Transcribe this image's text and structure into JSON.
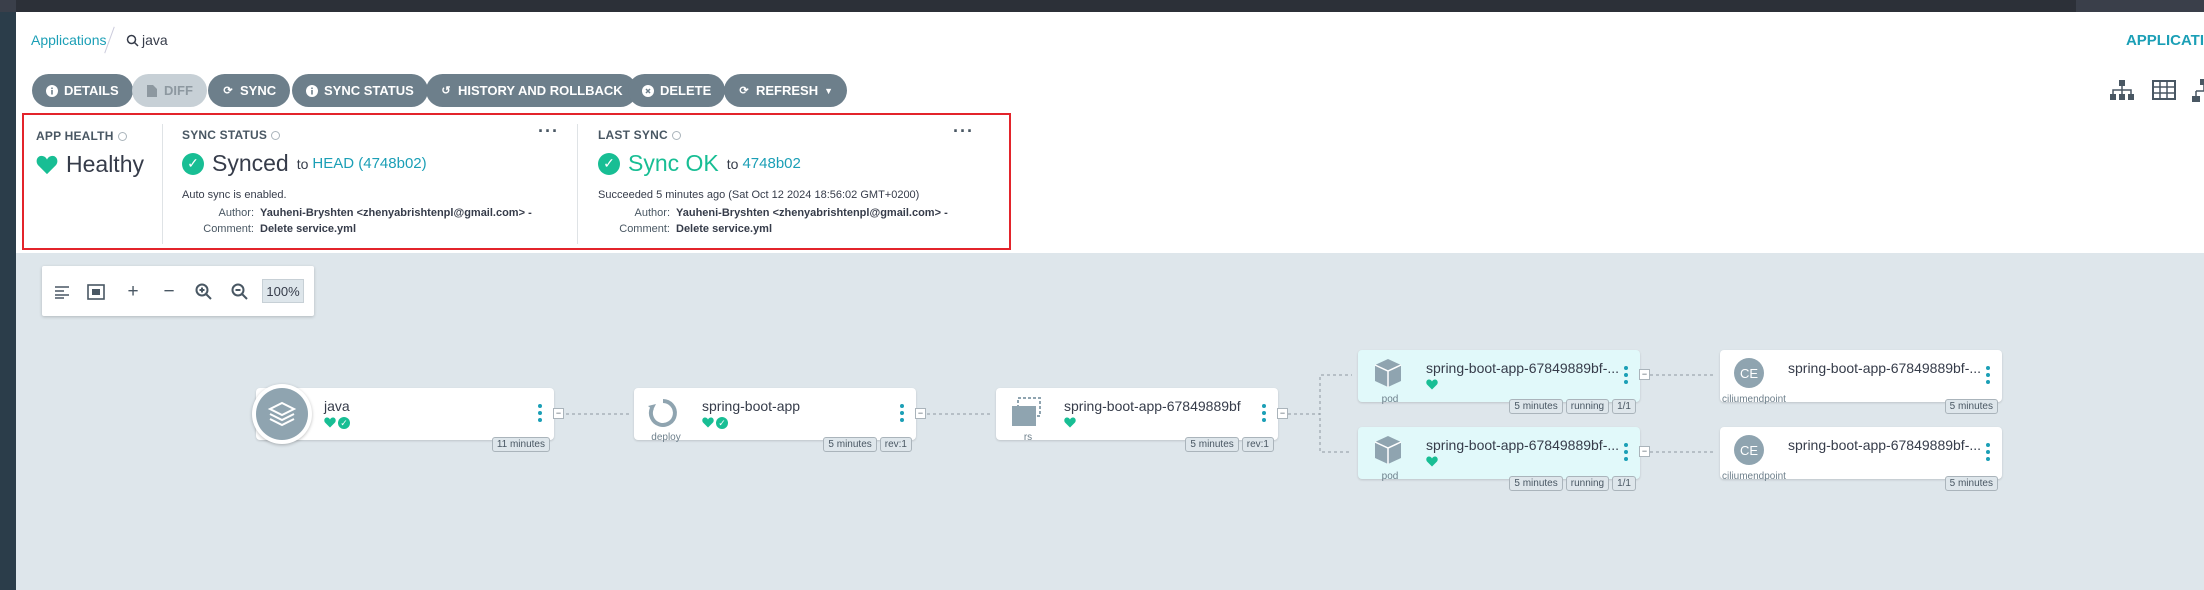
{
  "breadcrumb": {
    "applications": "Applications",
    "search": "java"
  },
  "header_right": "APPLICATI",
  "toolbar": [
    {
      "label": "DETAILS",
      "icon": "info-icon",
      "disabled": false
    },
    {
      "label": "DIFF",
      "icon": "file-icon",
      "disabled": true
    },
    {
      "label": "SYNC",
      "icon": "sync-icon",
      "disabled": false
    },
    {
      "label": "SYNC STATUS",
      "icon": "info-icon",
      "disabled": false
    },
    {
      "label": "HISTORY AND ROLLBACK",
      "icon": "history-icon",
      "disabled": false
    },
    {
      "label": "DELETE",
      "icon": "delete-icon",
      "disabled": false
    },
    {
      "label": "REFRESH",
      "icon": "refresh-icon",
      "disabled": false
    }
  ],
  "app_health": {
    "title": "APP HEALTH",
    "value": "Healthy"
  },
  "sync_status": {
    "title": "SYNC STATUS",
    "value": "Synced",
    "to": "to",
    "revision": "HEAD (4748b02)",
    "note": "Auto sync is enabled.",
    "author_label": "Author:",
    "author": "Yauheni-Bryshten <zhenyabrishtenpl@gmail.com> -",
    "comment_label": "Comment:",
    "comment": "Delete service.yml"
  },
  "last_sync": {
    "title": "LAST SYNC",
    "value": "Sync OK",
    "to": "to",
    "revision": "4748b02",
    "note": "Succeeded 5 minutes ago (Sat Oct 12 2024 18:56:02 GMT+0200)",
    "author_label": "Author:",
    "author": "Yauheni-Bryshten <zhenyabrishtenpl@gmail.com> -",
    "comment_label": "Comment:",
    "comment": "Delete service.yml"
  },
  "zoom": {
    "level": "100%"
  },
  "nodes": {
    "app": {
      "name": "java",
      "age": "11 minutes"
    },
    "deploy": {
      "name": "spring-boot-app",
      "kind": "deploy",
      "age": "5 minutes",
      "rev": "rev:1"
    },
    "rs": {
      "name": "spring-boot-app-67849889bf",
      "kind": "rs",
      "age": "5 minutes",
      "rev": "rev:1"
    },
    "pod1": {
      "name": "spring-boot-app-67849889bf-...",
      "kind": "pod",
      "age": "5 minutes",
      "state": "running",
      "ready": "1/1"
    },
    "pod2": {
      "name": "spring-boot-app-67849889bf-...",
      "kind": "pod",
      "age": "5 minutes",
      "state": "running",
      "ready": "1/1"
    },
    "ce1": {
      "name": "spring-boot-app-67849889bf-...",
      "kind": "ciliumendpoint",
      "abbr": "CE",
      "age": "5 minutes"
    },
    "ce2": {
      "name": "spring-boot-app-67849889bf-...",
      "kind": "ciliumendpoint",
      "abbr": "CE",
      "age": "5 minutes"
    }
  },
  "colors": {
    "accent": "#1b9fb6",
    "healthy": "#18be94",
    "highlight": "#e3242b"
  }
}
